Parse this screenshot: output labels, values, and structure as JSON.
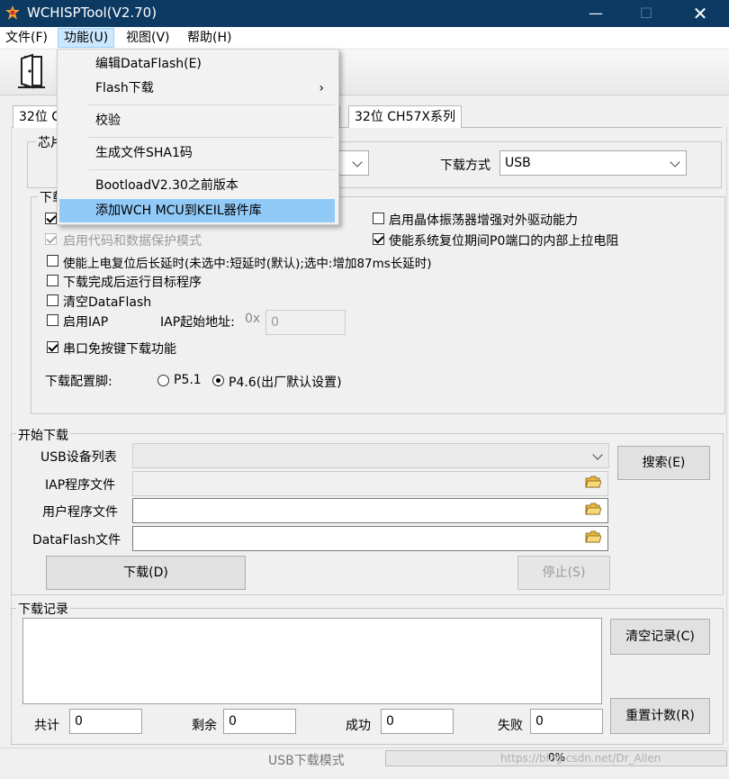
{
  "window": {
    "title": "WCHISPTool(V2.70)"
  },
  "menubar": {
    "file": "文件(F)",
    "function": "功能(U)",
    "view": "视图(V)",
    "help": "帮助(H)"
  },
  "dropdown": {
    "edit_dataflash": "编辑DataFlash(E)",
    "flash_download": "Flash下载",
    "verify": "校验",
    "gen_sha1": "生成文件SHA1码",
    "bootload_old": "BootloadV2.30之前版本",
    "add_keil": "添加WCH MCU到KEIL器件库"
  },
  "tabs": {
    "tab_first_partial": "32位 C",
    "tab_hidden_partial": "]",
    "tab_ch57x": "32位 CH57X系列"
  },
  "chip_group": {
    "label_partial": "芯片",
    "download_mode_label": "下载方式",
    "download_mode_value": "USB"
  },
  "config_group": {
    "label_partial": "下载",
    "enable_code_protect": "启用代码和数据保护模式",
    "enable_crystal_drive": "启用晶体振荡器增强对外驱动能力",
    "enable_p0_pullup": "使能系统复位期间P0端口的内部上拉电阻",
    "power_on_long_delay": "使能上电复位后长延时(未选中:短延时(默认);选中:增加87ms长延时)",
    "run_after_download": "下载完成后运行目标程序",
    "clear_dataflash": "清空DataFlash",
    "enable_iap": "启用IAP",
    "iap_start_label": "IAP起始地址:",
    "iap_prefix": "0x",
    "iap_value": "0",
    "serial_no_key": "串口免按键下载功能",
    "pin_label": "下载配置脚:",
    "pin_p51": "P5.1",
    "pin_p46": "P4.6(出厂默认设置)"
  },
  "start_group": {
    "label": "开始下载",
    "usb_list_label": "USB设备列表",
    "search_button": "搜索(E)",
    "iap_file_label": "IAP程序文件",
    "user_file_label": "用户程序文件",
    "dataflash_file_label": "DataFlash文件",
    "download_button": "下载(D)",
    "stop_button": "停止(S)"
  },
  "log_group": {
    "label": "下载记录",
    "clear_button": "清空记录(C)",
    "reset_button": "重置计数(R)",
    "total_label": "共计",
    "total_value": "0",
    "remain_label": "剩余",
    "remain_value": "0",
    "success_label": "成功",
    "success_value": "0",
    "fail_label": "失败",
    "fail_value": "0"
  },
  "statusbar": {
    "mode": "USB下载模式",
    "progress_text": "0%",
    "progress_value": 0,
    "watermark": "https://blog.csdn.net/Dr_Allen"
  },
  "colors": {
    "titlebar": "#0c3a63",
    "menu_highlight": "#91c9f7"
  }
}
